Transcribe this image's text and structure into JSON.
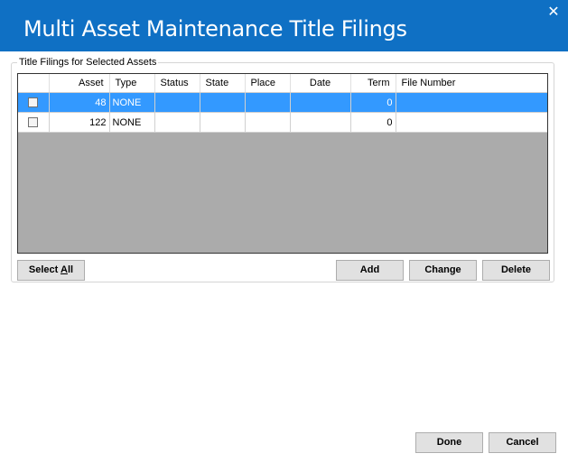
{
  "window": {
    "title": "Multi Asset Maintenance Title Filings",
    "close_glyph": "✕",
    "titlebar_color": "#0f70c4"
  },
  "group": {
    "legend": "Title Filings for Selected Assets"
  },
  "grid": {
    "columns": [
      "",
      "Asset",
      "Type",
      "Status",
      "State",
      "Place",
      "Date",
      "Term",
      "File Number"
    ],
    "rows": [
      {
        "checked": false,
        "selected": true,
        "asset": "48",
        "type": "NONE",
        "status": "",
        "state": "",
        "place": "",
        "date": "",
        "term": "0",
        "file_number": ""
      },
      {
        "checked": false,
        "selected": false,
        "asset": "122",
        "type": "NONE",
        "status": "",
        "state": "",
        "place": "",
        "date": "",
        "term": "0",
        "file_number": ""
      }
    ],
    "selection_color": "#3399ff",
    "empty_area_color": "#ababab"
  },
  "buttons": {
    "select_all_prefix": "Select ",
    "select_all_mnemonic": "A",
    "select_all_suffix": "ll",
    "add": "Add",
    "change": "Change",
    "delete": "Delete",
    "done": "Done",
    "cancel": "Cancel"
  }
}
